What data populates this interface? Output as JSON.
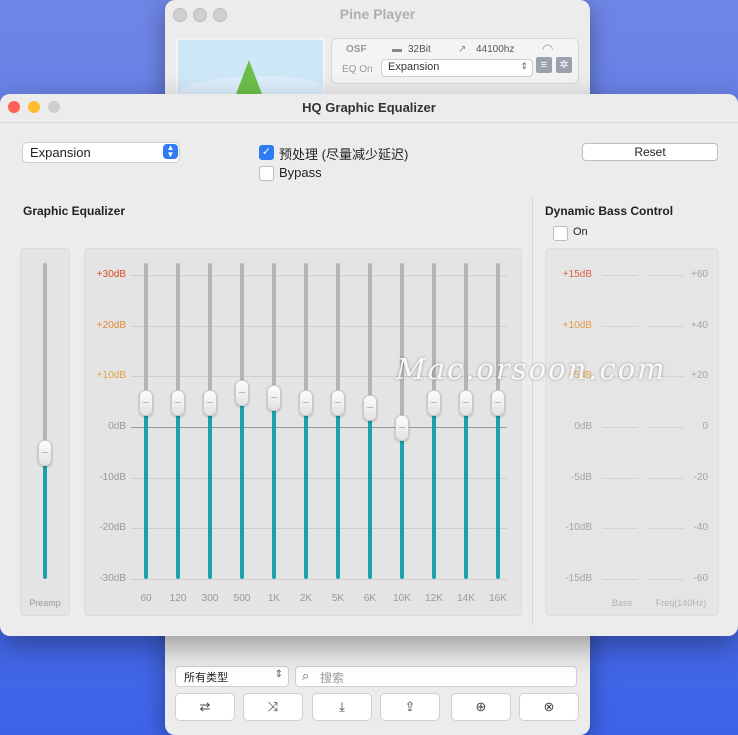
{
  "background_window": {
    "title": "Pine Player",
    "info": {
      "format": "OSF",
      "bit_depth": "32Bit",
      "sample_rate": "44100hz",
      "eq_state": "EQ On"
    },
    "eq_preset": "Expansion",
    "filter_type": "所有类型",
    "search_placeholder": "搜索",
    "toolbar_icons": [
      "repeat-icon",
      "shuffle-icon",
      "import-icon",
      "share-icon",
      "add-file-icon",
      "close-circle-icon"
    ]
  },
  "eq_window": {
    "title": "HQ Graphic Equalizer",
    "preset": "Expansion",
    "preprocess_label": "预处理 (尽量减少延迟)",
    "preprocess_checked": true,
    "bypass_label": "Bypass",
    "bypass_checked": false,
    "reset_label": "Reset",
    "graphic_title": "Graphic Equalizer",
    "db_labels": [
      "+30dB",
      "+20dB",
      "+10dB",
      "0dB",
      "-10dB",
      "-20dB",
      "-30dB"
    ],
    "preamp_label": "Preamp",
    "preamp_value_db": -5,
    "bands": [
      {
        "freq": "60",
        "gain_db": 5
      },
      {
        "freq": "120",
        "gain_db": 5
      },
      {
        "freq": "300",
        "gain_db": 5
      },
      {
        "freq": "500",
        "gain_db": 7
      },
      {
        "freq": "1K",
        "gain_db": 6
      },
      {
        "freq": "2K",
        "gain_db": 5
      },
      {
        "freq": "5K",
        "gain_db": 5
      },
      {
        "freq": "6K",
        "gain_db": 4
      },
      {
        "freq": "10K",
        "gain_db": 0
      },
      {
        "freq": "12K",
        "gain_db": 5
      },
      {
        "freq": "14K",
        "gain_db": 5
      },
      {
        "freq": "16K",
        "gain_db": 5
      }
    ],
    "bass": {
      "title": "Dynamic Bass Control",
      "on_label": "On",
      "on_checked": false,
      "left_labels": [
        "+15dB",
        "+10dB",
        "+5dB",
        "0dB",
        "-5dB",
        "-10dB",
        "-15dB"
      ],
      "right_labels": [
        "+60",
        "+40",
        "+20",
        "0",
        "-20",
        "-40",
        "-60"
      ],
      "bass_label": "Bass",
      "freq_label": "Freq(140Hz)"
    }
  },
  "watermark": "Mac.orsoon.com",
  "colors": {
    "accent": "#2f7bf5",
    "fill": "#1aa3ad",
    "close": "#fe5f57",
    "minimize": "#febc2e",
    "zoom": "#cfcfcf"
  }
}
